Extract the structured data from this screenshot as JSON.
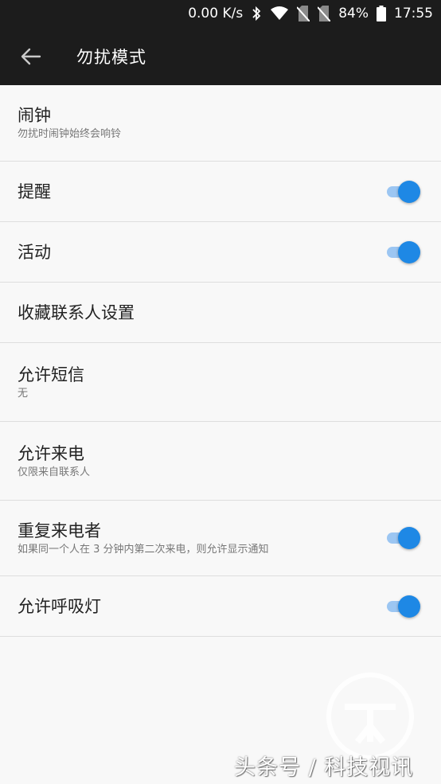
{
  "status_bar": {
    "speed": "0.00 K/s",
    "battery": "84%",
    "time": "17:55",
    "icons": [
      "bluetooth-icon",
      "wifi-icon",
      "no-sim-icon",
      "no-sim-icon",
      "battery-icon"
    ]
  },
  "app_bar": {
    "title": "勿扰模式"
  },
  "settings": [
    {
      "title": "闹钟",
      "subtitle": "勿扰时闹钟始终会响铃",
      "toggle": null
    },
    {
      "title": "提醒",
      "subtitle": "",
      "toggle": true
    },
    {
      "title": "活动",
      "subtitle": "",
      "toggle": true
    },
    {
      "title": "收藏联系人设置",
      "subtitle": "",
      "toggle": null
    },
    {
      "title": "允许短信",
      "subtitle": "无",
      "toggle": null
    },
    {
      "title": "允许来电",
      "subtitle": "仅限来自联系人",
      "toggle": null
    },
    {
      "title": "重复来电者",
      "subtitle": "如果同一个人在 3 分钟内第二次来电，则允许显示通知",
      "toggle": true
    },
    {
      "title": "允许呼吸灯",
      "subtitle": "",
      "toggle": true
    }
  ],
  "watermark": {
    "text": "头条号 / 科技视讯"
  },
  "colors": {
    "app_bar": "#1c1c1c",
    "accent": "#1e88e5",
    "track": "#9cc6f2"
  }
}
